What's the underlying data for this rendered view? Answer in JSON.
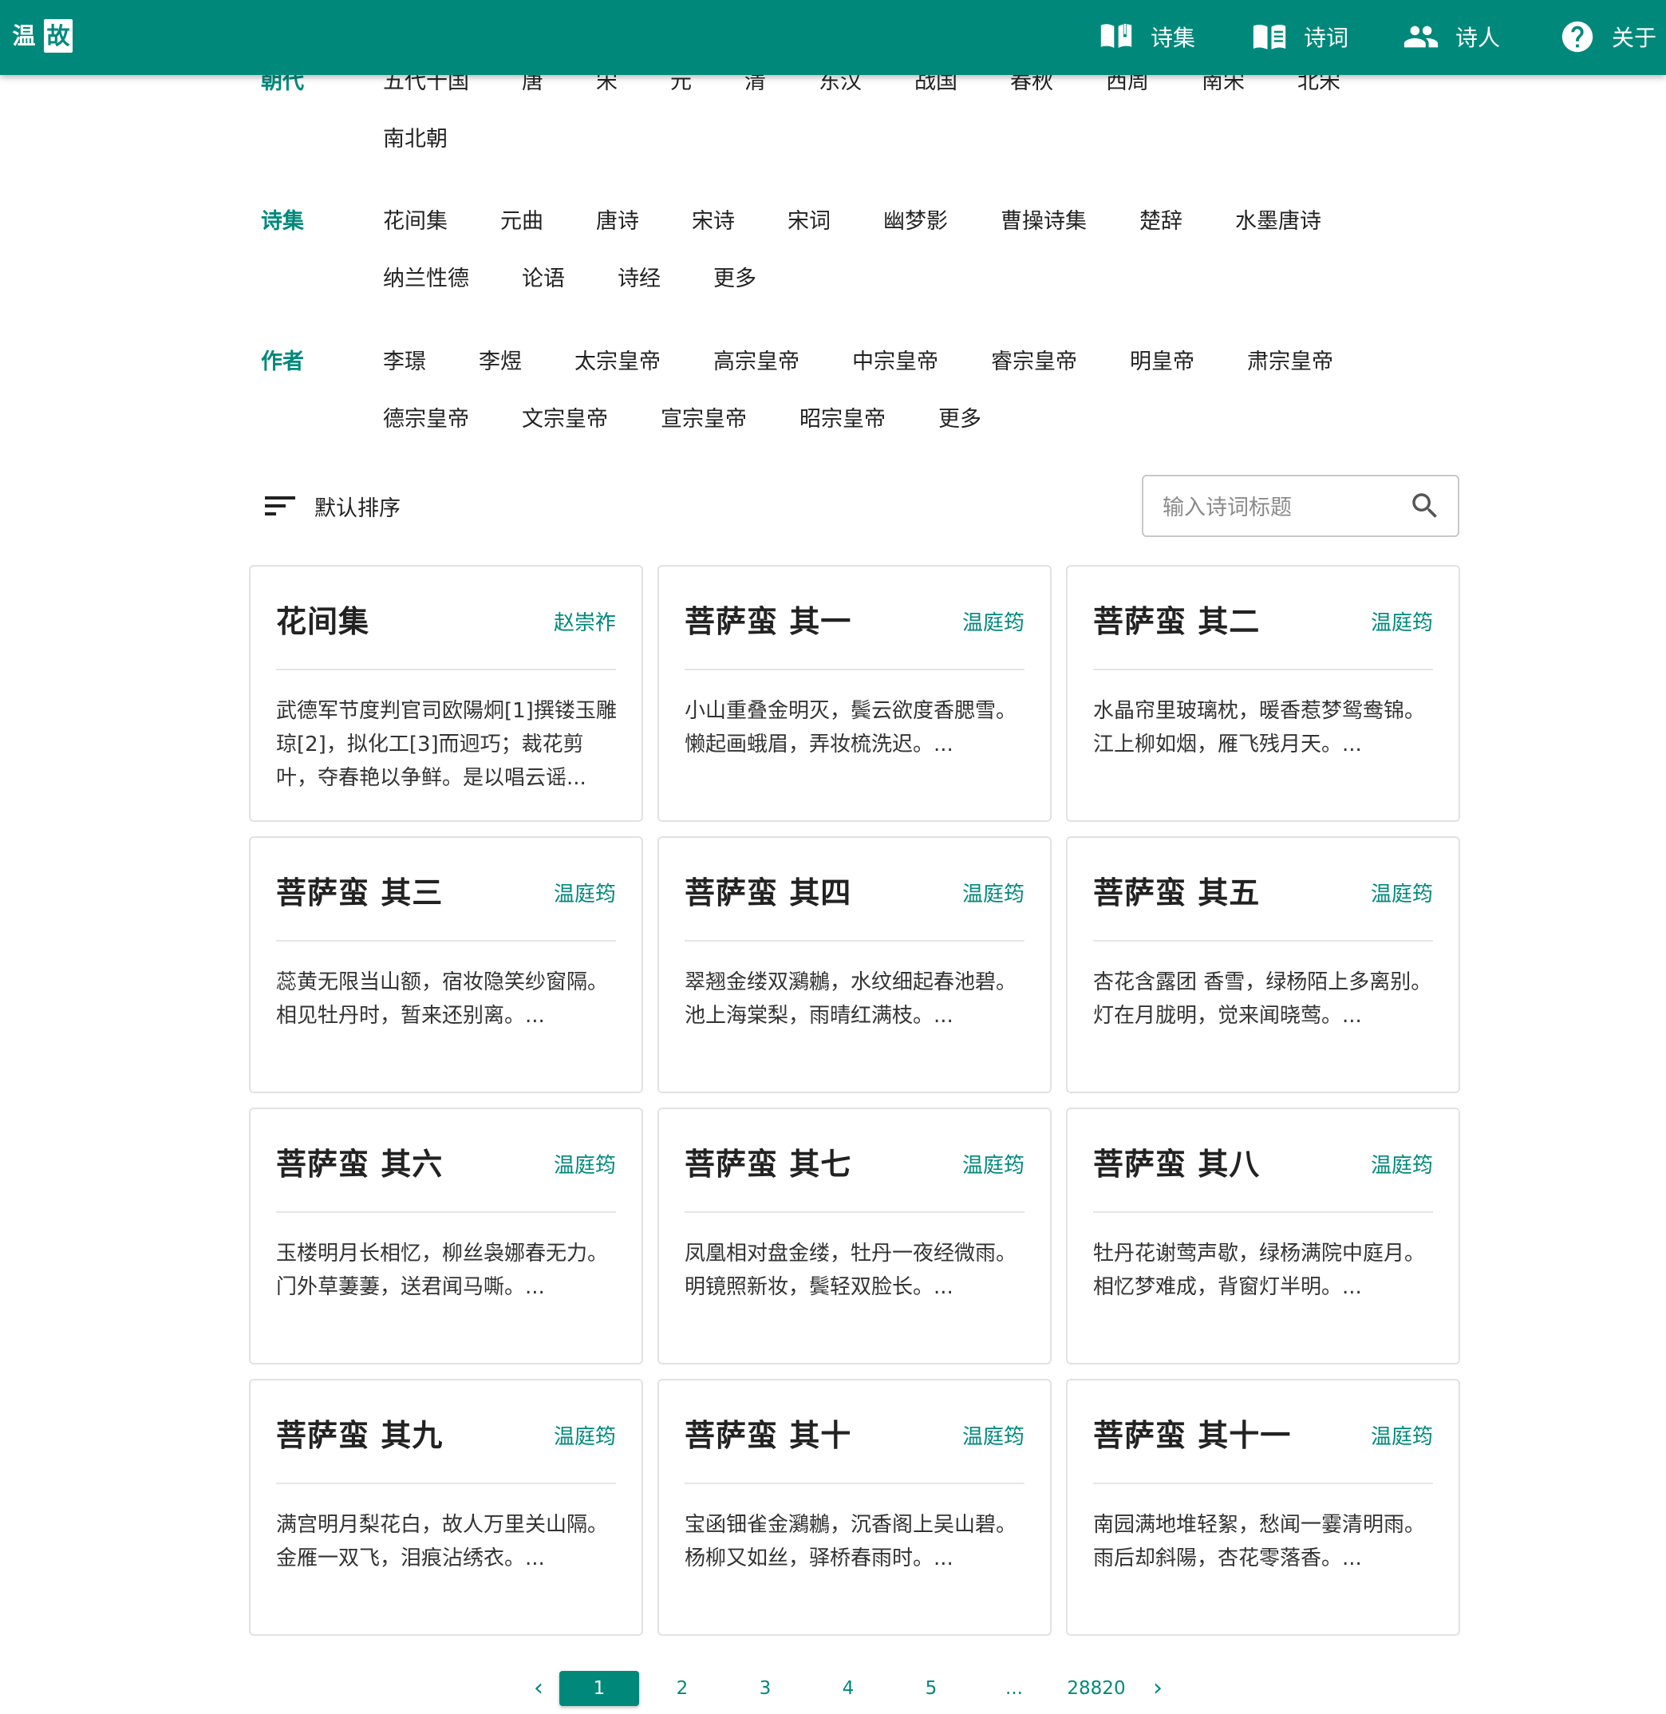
{
  "app": {
    "logo_left": "温",
    "logo_right": "故",
    "nav": {
      "collections": "诗集",
      "ci": "诗词",
      "poets": "诗人",
      "about": "关于"
    }
  },
  "filters": {
    "dynasty": {
      "label": "朝代",
      "options": [
        "五代十国",
        "唐",
        "宋",
        "元",
        "清",
        "东汉",
        "战国",
        "春秋",
        "西周",
        "南宋",
        "北宋",
        "南北朝"
      ]
    },
    "collection": {
      "label": "诗集",
      "options": [
        "花间集",
        "元曲",
        "唐诗",
        "宋诗",
        "宋词",
        "幽梦影",
        "曹操诗集",
        "楚辞",
        "水墨唐诗",
        "纳兰性德",
        "论语",
        "诗经",
        "更多"
      ]
    },
    "author": {
      "label": "作者",
      "options": [
        "李璟",
        "李煜",
        "太宗皇帝",
        "高宗皇帝",
        "中宗皇帝",
        "睿宗皇帝",
        "明皇帝",
        "肃宗皇帝",
        "德宗皇帝",
        "文宗皇帝",
        "宣宗皇帝",
        "昭宗皇帝",
        "更多"
      ]
    }
  },
  "sort": {
    "label": "默认排序"
  },
  "search": {
    "placeholder": "输入诗词标题",
    "value": ""
  },
  "cards": [
    {
      "title": "花间集",
      "author": "赵崇祚",
      "excerpt": "武德军节度判官司欧陽炯[1]撰镂玉雕琼[2]，拟化工[3]而迥巧；裁花剪叶，夺春艳以争鲜。是以唱云谣..."
    },
    {
      "title": "菩萨蛮 其一",
      "author": "温庭筠",
      "excerpt": "小山重叠金明灭，鬓云欲度香腮雪。\n懒起画蛾眉，弄妆梳洗迟。..."
    },
    {
      "title": "菩萨蛮 其二",
      "author": "温庭筠",
      "excerpt": "水晶帘里玻璃枕，暖香惹梦鸳鸯锦。\n江上柳如烟，雁飞残月天。..."
    },
    {
      "title": "菩萨蛮 其三",
      "author": "温庭筠",
      "excerpt": "蕊黄无限当山额，宿妆隐笑纱窗隔。\n相见牡丹时，暂来还别离。..."
    },
    {
      "title": "菩萨蛮 其四",
      "author": "温庭筠",
      "excerpt": "翠翘金缕双鸂鶒，水纹细起春池碧。\n池上海棠梨，雨晴红满枝。..."
    },
    {
      "title": "菩萨蛮 其五",
      "author": "温庭筠",
      "excerpt": "杏花含露团 香雪，绿杨陌上多离别。\n灯在月胧明，觉来闻晓莺。..."
    },
    {
      "title": "菩萨蛮 其六",
      "author": "温庭筠",
      "excerpt": "玉楼明月长相忆，柳丝袅娜春无力。\n门外草萋萋，送君闻马嘶。..."
    },
    {
      "title": "菩萨蛮 其七",
      "author": "温庭筠",
      "excerpt": "凤凰相对盘金缕，牡丹一夜经微雨。\n明镜照新妆，鬓轻双脸长。..."
    },
    {
      "title": "菩萨蛮 其八",
      "author": "温庭筠",
      "excerpt": "牡丹花谢莺声歇，绿杨满院中庭月。\n相忆梦难成，背窗灯半明。..."
    },
    {
      "title": "菩萨蛮 其九",
      "author": "温庭筠",
      "excerpt": "满宫明月梨花白，故人万里关山隔。\n金雁一双飞，泪痕沾绣衣。..."
    },
    {
      "title": "菩萨蛮 其十",
      "author": "温庭筠",
      "excerpt": "宝函钿雀金鸂鶒，沉香阁上吴山碧。\n杨柳又如丝，驿桥春雨时。..."
    },
    {
      "title": "菩萨蛮 其十一",
      "author": "温庭筠",
      "excerpt": "南园满地堆轻絮，愁闻一霎清明雨。\n雨后却斜陽，杏花零落香。..."
    }
  ],
  "pagination": {
    "prev": "‹",
    "current": "1",
    "pages": [
      "2",
      "3",
      "4",
      "5"
    ],
    "ellipsis": "...",
    "last": "28820",
    "next": "›"
  },
  "colors": {
    "accent": "#00897b",
    "text": "#222222",
    "border": "#e2e2e2"
  },
  "icons": {
    "collections": "open-book-icon",
    "ci": "book-page-icon",
    "poets": "people-icon",
    "about": "help-circle-icon",
    "sort": "sort-lines-icon",
    "search": "search-icon"
  }
}
